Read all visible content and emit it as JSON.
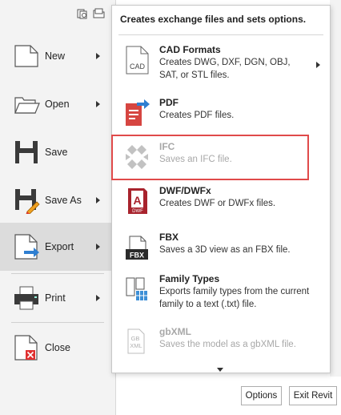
{
  "menu": {
    "commands": [
      {
        "label": "New",
        "icon": "new-document-icon",
        "has_submenu": true
      },
      {
        "label": "Open",
        "icon": "open-folder-icon",
        "has_submenu": true
      },
      {
        "label": "Save",
        "icon": "floppy-disk-icon",
        "has_submenu": false
      },
      {
        "label": "Save As",
        "icon": "save-as-icon",
        "has_submenu": true
      },
      {
        "label": "Export",
        "icon": "export-icon",
        "has_submenu": true,
        "active": true
      },
      {
        "label": "Print",
        "icon": "printer-icon",
        "has_submenu": true
      },
      {
        "label": "Close",
        "icon": "close-document-icon",
        "has_submenu": false
      }
    ],
    "top_icons": [
      "recent-documents-icon",
      "open-documents-icon"
    ]
  },
  "flyout": {
    "header": "Creates exchange files and sets options.",
    "items": [
      {
        "title": "CAD Formats",
        "description": "Creates DWG, DXF, DGN, OBJ, SAT, or STL files.",
        "icon": "cad-icon",
        "icon_text": "CAD",
        "has_submenu": true,
        "enabled": true
      },
      {
        "title": "PDF",
        "description": "Creates PDF files.",
        "icon": "pdf-export-icon",
        "enabled": true
      },
      {
        "title": "IFC",
        "description": "Saves an IFC file.",
        "icon": "ifc-icon",
        "enabled": false,
        "highlighted": true
      },
      {
        "title": "DWF/DWFx",
        "description": "Creates DWF or DWFx files.",
        "icon": "dwf-icon",
        "icon_text": "DWF",
        "enabled": true
      },
      {
        "title": "FBX",
        "description": "Saves a 3D view as an FBX file.",
        "icon": "fbx-icon",
        "icon_text": "FBX",
        "enabled": true
      },
      {
        "title": "Family Types",
        "description": "Exports family types from the current family to a text (.txt) file.",
        "icon": "family-types-icon",
        "enabled": true
      },
      {
        "title": "gbXML",
        "description": "Saves the model as a gbXML file.",
        "icon": "gbxml-icon",
        "icon_text": "GB\nXML",
        "enabled": false
      }
    ]
  },
  "buttons": {
    "options": "Options",
    "exit": "Exit Revit"
  },
  "colors": {
    "highlight_border": "#e04a4a",
    "active_command_bg": "#dcdcdc",
    "pdf_red": "#d64541",
    "export_arrow_blue": "#2f7fd1"
  }
}
